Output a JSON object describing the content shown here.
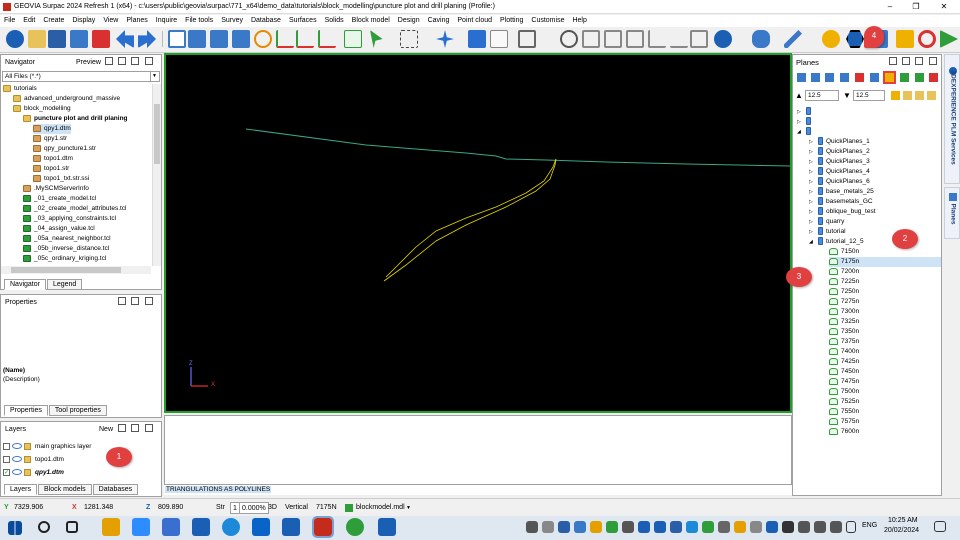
{
  "window": {
    "title": "GEOVIA Surpac 2024 Refresh 1 (x64) - c:\\users\\public\\geovia\\surpac\\771_x64\\demo_data\\tutorials\\block_modelling\\puncture plot and drill planing (Profile:)",
    "minimize": "–",
    "restore": "❐",
    "close": "✕"
  },
  "menu": [
    "File",
    "Edit",
    "Create",
    "Display",
    "View",
    "Planes",
    "Inquire",
    "File tools",
    "Survey",
    "Database",
    "Surfaces",
    "Solids",
    "Block model",
    "Design",
    "Caving",
    "Point cloud",
    "Plotting",
    "Customise",
    "Help"
  ],
  "navigator": {
    "title": "Navigator",
    "preview": "Preview",
    "filter": "All Files (*.*)",
    "items": [
      {
        "label": "tutorials",
        "type": "folder",
        "indent": 0
      },
      {
        "label": "advanced_underground_massive",
        "type": "folder",
        "indent": 1
      },
      {
        "label": "block_modelling",
        "type": "folder",
        "indent": 1
      },
      {
        "label": "puncture plot and drill planing",
        "type": "folder",
        "indent": 2,
        "bold": true
      },
      {
        "label": "qpy1.dtm",
        "type": "file",
        "indent": 3,
        "selected": true
      },
      {
        "label": "qpy1.str",
        "type": "file",
        "indent": 3
      },
      {
        "label": "qpy_puncture1.str",
        "type": "file",
        "indent": 3
      },
      {
        "label": "topo1.dtm",
        "type": "file",
        "indent": 3
      },
      {
        "label": "topo1.str",
        "type": "file",
        "indent": 3
      },
      {
        "label": "topo1_txt.str.ssi",
        "type": "file",
        "indent": 3
      },
      {
        "label": ".MySCMServerInfo",
        "type": "doc",
        "indent": 2
      },
      {
        "label": "_01_create_model.tcl",
        "type": "tcl",
        "indent": 2
      },
      {
        "label": "_02_create_model_attributes.tcl",
        "type": "tcl",
        "indent": 2
      },
      {
        "label": "_03_applying_constraints.tcl",
        "type": "tcl",
        "indent": 2
      },
      {
        "label": "_04_assign_value.tcl",
        "type": "tcl",
        "indent": 2
      },
      {
        "label": "_05a_nearest_neighbor.tcl",
        "type": "tcl",
        "indent": 2
      },
      {
        "label": "_05b_inverse_distance.tcl",
        "type": "tcl",
        "indent": 2
      },
      {
        "label": "_05c_ordinary_kriging.tcl",
        "type": "tcl",
        "indent": 2
      }
    ],
    "tabs": [
      "Navigator",
      "Legend"
    ]
  },
  "properties": {
    "title": "Properties",
    "name_label": "(Name)",
    "desc_label": "(Description)",
    "tabs": [
      "Properties",
      "Tool properties"
    ]
  },
  "layers": {
    "title": "Layers",
    "new_label": "New",
    "items": [
      {
        "label": "main graphics layer",
        "checked": false,
        "bold": false
      },
      {
        "label": "topo1.dtm",
        "checked": false,
        "bold": false
      },
      {
        "label": "qpy1.dtm",
        "checked": true,
        "bold": true
      }
    ],
    "tabs": [
      "Layers",
      "Block models",
      "Databases"
    ]
  },
  "console": {
    "input_value": "TRIANGULATIONS AS POLYLINES"
  },
  "viewport": {
    "axis_z": "Z",
    "axis_x": "X"
  },
  "planes": {
    "title": "Planes",
    "up_value": "12.5",
    "down_value": "12.5",
    "top_items": [
      "",
      "",
      ""
    ],
    "items": [
      "QuickPlanes_1",
      "QuickPlanes_2",
      "QuickPlanes_3",
      "QuickPlanes_4",
      "QuickPlanes_6",
      "base_metals_25",
      "basemetals_GC",
      "oblique_bug_test",
      "quarry",
      "tutorial",
      "tutorial_12_5"
    ],
    "sections": [
      "7150n",
      "7175n",
      "7200n",
      "7225n",
      "7250n",
      "7275n",
      "7300n",
      "7325n",
      "7350n",
      "7375n",
      "7400n",
      "7425n",
      "7450n",
      "7475n",
      "7500n",
      "7525n",
      "7550n",
      "7575n",
      "7600n"
    ],
    "selected_section": "7175n"
  },
  "side_tabs": [
    "3DEXPERIENCE PLM Services",
    "Planes"
  ],
  "callouts": [
    "1",
    "2",
    "3",
    "4"
  ],
  "status": {
    "y": "7329.906",
    "x": "1281.348",
    "z": "809.890",
    "str_label": "Str",
    "str_value": "1",
    "zoom": "0.000%",
    "view3d": "3D",
    "vertical": "Vertical",
    "section": "7175N",
    "blockmodel": "blockmodel.mdl"
  },
  "taskbar": {
    "time": "10:25 AM",
    "date": "20/02/2024",
    "lang": "ENG"
  },
  "colors": {
    "viewport_bg": "#000000",
    "topo_line": "#3aa88a",
    "orebody_line": "#e6d800",
    "accent_green": "#1fa02a",
    "callout_red": "#e04040",
    "selection_blue": "#cfe3f7"
  }
}
